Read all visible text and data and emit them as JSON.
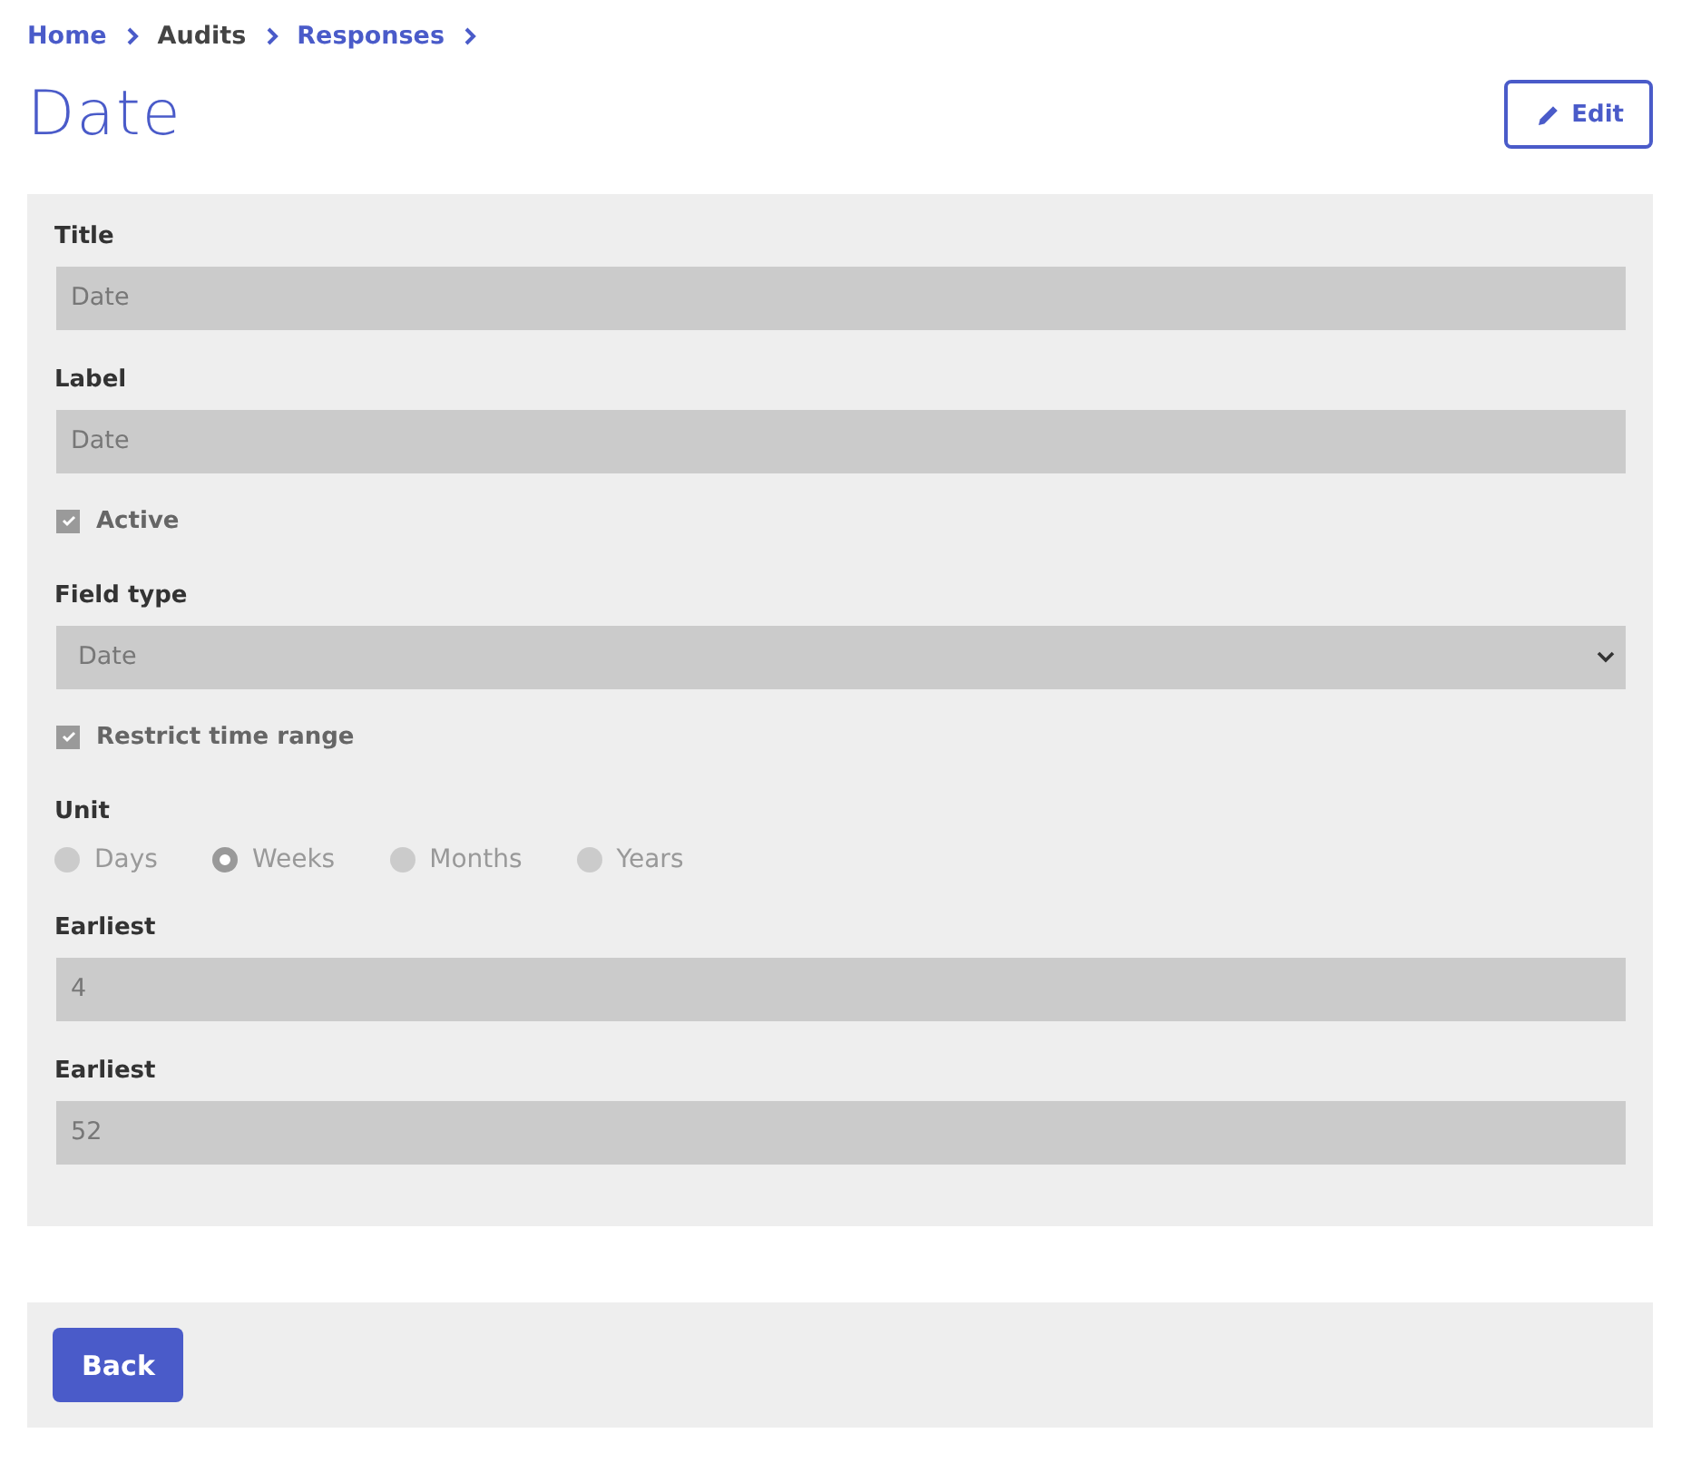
{
  "breadcrumbs": [
    {
      "label": "Home",
      "link": true
    },
    {
      "label": "Audits",
      "link": false
    },
    {
      "label": "Responses",
      "link": true
    }
  ],
  "title": "Date",
  "edit_button": {
    "label": "Edit"
  },
  "fields": [
    {
      "kind": "text",
      "label": "Title",
      "value": "Date"
    },
    {
      "kind": "text",
      "label": "Label",
      "value": "Date"
    },
    {
      "kind": "checkbox",
      "label": "Active",
      "checked": true
    },
    {
      "kind": "select",
      "label": "Field type",
      "value": "Date"
    },
    {
      "kind": "checkbox",
      "label": "Restrict time range",
      "checked": true
    },
    {
      "kind": "radio",
      "label": "Unit",
      "options": [
        {
          "label": "Days",
          "selected": false
        },
        {
          "label": "Weeks",
          "selected": true
        },
        {
          "label": "Months",
          "selected": false
        },
        {
          "label": "Years",
          "selected": false
        }
      ]
    },
    {
      "kind": "text",
      "label": "Earliest",
      "value": "4"
    },
    {
      "kind": "text",
      "label": "Earliest",
      "value": "52"
    }
  ],
  "back_button": {
    "label": "Back"
  }
}
